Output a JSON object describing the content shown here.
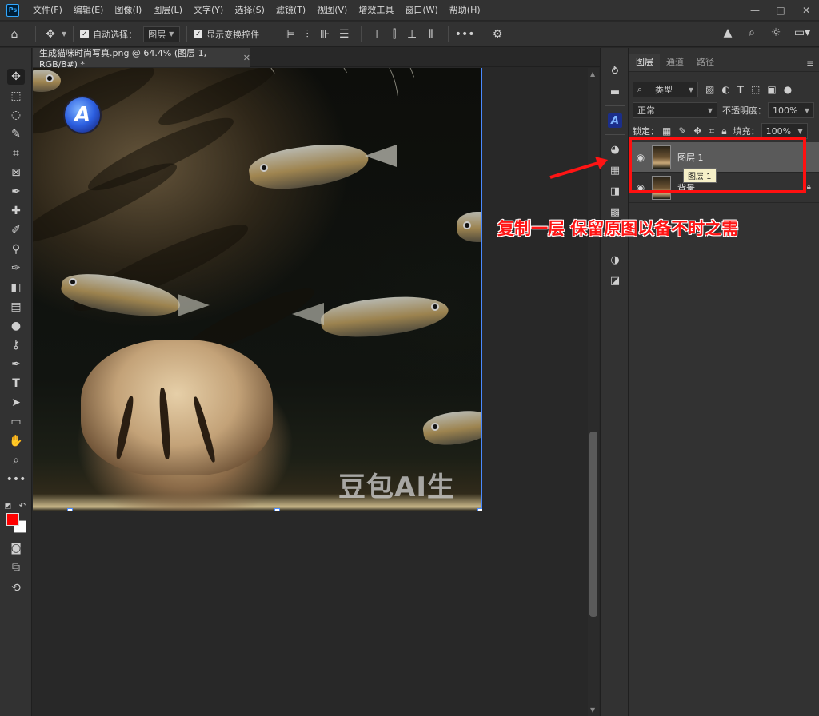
{
  "menu": {
    "items": [
      "文件(F)",
      "编辑(E)",
      "图像(I)",
      "图层(L)",
      "文字(Y)",
      "选择(S)",
      "滤镜(T)",
      "视图(V)",
      "增效工具",
      "窗口(W)",
      "帮助(H)"
    ]
  },
  "options": {
    "auto_select_label": "自动选择：",
    "auto_select_value": "图层",
    "show_transform_label": "显示变换控件"
  },
  "document": {
    "tab_title": "生成猫咪时尚写真.png @ 64.4% (图层 1, RGB/8#) *",
    "watermark": "豆包AI生成",
    "logo_letter": "A"
  },
  "layers_panel": {
    "tabs": [
      "图层",
      "通道",
      "路径"
    ],
    "filter_label": "类型",
    "blend_mode": "正常",
    "opacity_label": "不透明度：",
    "opacity_value": "100%",
    "lock_label": "锁定：",
    "fill_label": "填充：",
    "fill_value": "100%",
    "layers": [
      {
        "name": "图层 1",
        "selected": true
      },
      {
        "name": "背景",
        "selected": false
      }
    ],
    "tooltip": "图层 1"
  },
  "annotation": {
    "text": "复制一层 保留原图以备不时之需",
    "color": "#ff1414"
  },
  "colors": {
    "foreground": "#ff0000",
    "background": "#ffffff"
  }
}
